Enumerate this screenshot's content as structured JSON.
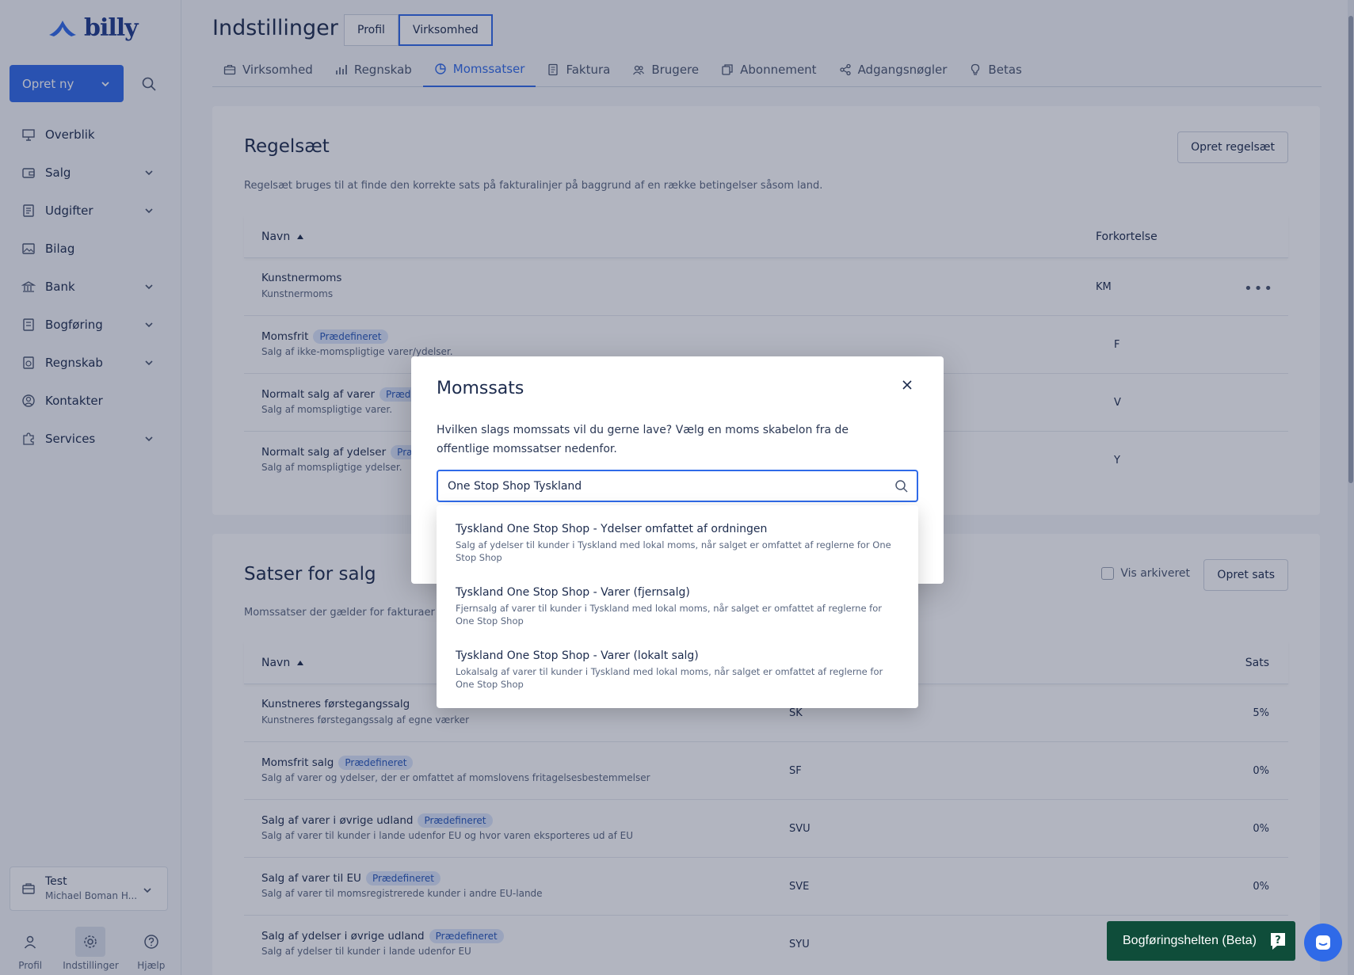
{
  "brand": {
    "name": "billy",
    "accent": "#2f6ae8"
  },
  "sidebar": {
    "create_label": "Opret ny",
    "items": [
      {
        "label": "Overblik",
        "icon": "presentation-icon",
        "has_chevron": false
      },
      {
        "label": "Salg",
        "icon": "wallet-icon",
        "has_chevron": true
      },
      {
        "label": "Udgifter",
        "icon": "receipt-icon",
        "has_chevron": true
      },
      {
        "label": "Bilag",
        "icon": "image-icon",
        "has_chevron": false
      },
      {
        "label": "Bank",
        "icon": "bank-icon",
        "has_chevron": true
      },
      {
        "label": "Bogføring",
        "icon": "ledger-icon",
        "has_chevron": true
      },
      {
        "label": "Regnskab",
        "icon": "report-icon",
        "has_chevron": true
      },
      {
        "label": "Kontakter",
        "icon": "user-circle-icon",
        "has_chevron": false
      },
      {
        "label": "Services",
        "icon": "puzzle-icon",
        "has_chevron": true
      }
    ],
    "org": {
      "name": "Test",
      "user": "Michael Boman H..."
    },
    "bottom": [
      {
        "label": "Profil",
        "icon": "user-icon"
      },
      {
        "label": "Indstillinger",
        "icon": "gear-icon",
        "active": true
      },
      {
        "label": "Hjælp",
        "icon": "help-icon"
      }
    ]
  },
  "header": {
    "title": "Indstillinger",
    "segments": [
      "Profil",
      "Virksomhed"
    ],
    "active_segment": "Virksomhed"
  },
  "tabs": [
    {
      "label": "Virksomhed",
      "icon": "briefcase-icon"
    },
    {
      "label": "Regnskab",
      "icon": "bar-chart-icon"
    },
    {
      "label": "Momssatser",
      "icon": "pie-chart-icon",
      "active": true
    },
    {
      "label": "Faktura",
      "icon": "document-icon"
    },
    {
      "label": "Brugere",
      "icon": "users-icon"
    },
    {
      "label": "Abonnement",
      "icon": "copy-icon"
    },
    {
      "label": "Adgangsnøgler",
      "icon": "share-icon"
    },
    {
      "label": "Betas",
      "icon": "lightbulb-icon"
    }
  ],
  "regelsaet": {
    "title": "Regelsæt",
    "description": "Regelsæt bruges til at finde den korrekte sats på fakturalinjer på baggrund af en række betingelser såsom land.",
    "create_label": "Opret regelsæt",
    "columns": {
      "name": "Navn",
      "abbr": "Forkortelse"
    },
    "rows": [
      {
        "name": "Kunstnermoms",
        "sub": "Kunstnermoms",
        "abbr": "KM",
        "badge": ""
      },
      {
        "name": "Momsfrit",
        "sub": "Salg af ikke-momspligtige varer/ydelser.",
        "abbr": "F",
        "badge": "Prædefineret"
      },
      {
        "name": "Normalt salg af varer",
        "sub": "Salg af momspligtige varer.",
        "abbr": "V",
        "badge": "Prædefineret"
      },
      {
        "name": "Normalt salg af ydelser",
        "sub": "Salg af momspligtige ydelser.",
        "abbr": "Y",
        "badge": "Prædefineret"
      }
    ]
  },
  "satser": {
    "title": "Satser for salg",
    "description": "Momssatser der gælder for fakturaer og",
    "archived_label": "Vis arkiveret",
    "create_label": "Opret sats",
    "columns": {
      "name": "Navn",
      "rate": "Sats"
    },
    "rows": [
      {
        "name": "Kunstneres førstegangssalg",
        "sub": "Kunstneres førstegangssalg af egne værker",
        "abbr": "SK",
        "rate": "5%",
        "badge": ""
      },
      {
        "name": "Momsfrit salg",
        "sub": "Salg af varer og ydelser, der er omfattet af momslovens fritagelsesbestemmelser",
        "abbr": "SF",
        "rate": "0%",
        "badge": "Prædefineret"
      },
      {
        "name": "Salg af varer i øvrige udland",
        "sub": "Salg af varer til kunder i lande udenfor EU og hvor varen eksporteres ud af EU",
        "abbr": "SVU",
        "rate": "0%",
        "badge": "Prædefineret"
      },
      {
        "name": "Salg af varer til EU",
        "sub": "Salg af varer til momsregistrerede kunder i andre EU-lande",
        "abbr": "SVE",
        "rate": "0%",
        "badge": "Prædefineret"
      },
      {
        "name": "Salg af ydelser i øvrige udland",
        "sub": "Salg af ydelser til kunder i lande udenfor EU",
        "abbr": "SYU",
        "rate": "",
        "badge": "Prædefineret"
      }
    ]
  },
  "modal": {
    "title": "Momssats",
    "text": "Hvilken slags momssats vil du gerne lave? Vælg en moms skabelon fra de offentlige momssatser nedenfor.",
    "search_value": "One Stop Shop Tyskland",
    "results": [
      {
        "title": "Tyskland One Stop Shop - Ydelser omfattet af ordningen",
        "desc": "Salg af ydelser til kunder i Tyskland med lokal moms, når salget er omfattet af reglerne for One Stop Shop"
      },
      {
        "title": "Tyskland One Stop Shop - Varer (fjernsalg)",
        "desc": "Fjernsalg af varer til kunder i Tyskland med lokal moms, når salget er omfattet af reglerne for One Stop Shop"
      },
      {
        "title": "Tyskland One Stop Shop - Varer (lokalt salg)",
        "desc": "Lokalsalg af varer til kunder i Tyskland med lokal moms, når salget er omfattet af reglerne for One Stop Shop"
      }
    ]
  },
  "helper": {
    "label": "Bogføringshelten (Beta)"
  }
}
